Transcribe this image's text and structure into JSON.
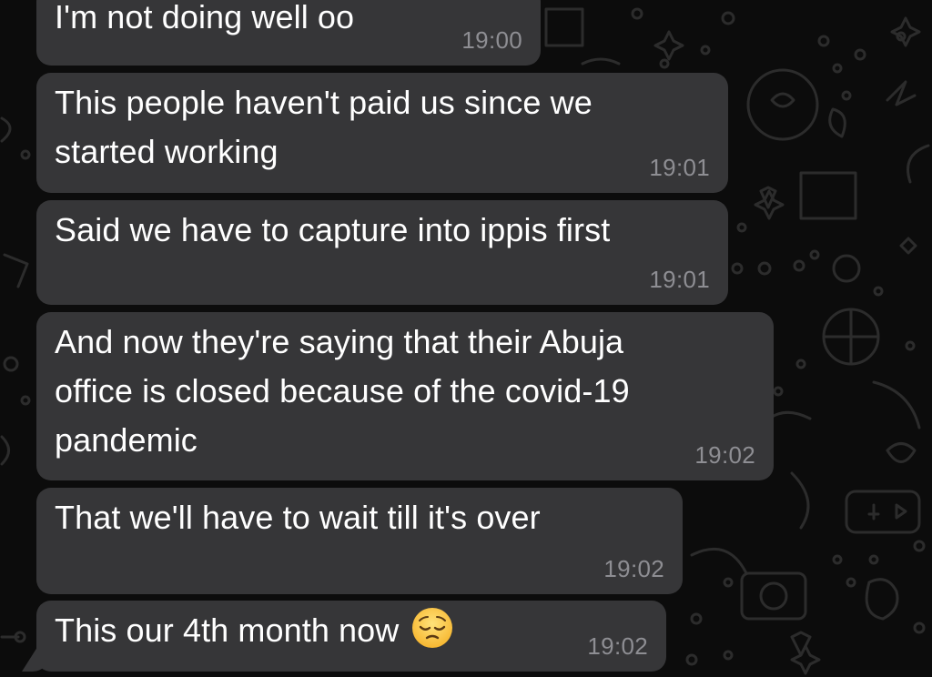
{
  "messages": [
    {
      "text": "I'm not doing well oo",
      "time": "19:00"
    },
    {
      "text": "This people haven't paid us since we",
      "text2": "started working",
      "time": "19:01"
    },
    {
      "text": "Said we have to capture into ippis first",
      "time": "19:01"
    },
    {
      "text": "And now they're saying that their Abuja",
      "text2": "office is closed because of the covid-19",
      "text3": "pandemic",
      "time": "19:02"
    },
    {
      "text": "That we'll have to wait till it's over",
      "time": "19:02"
    },
    {
      "text": "This our 4th month now",
      "emoji": "pensive-face-emoji",
      "time": "19:02"
    }
  ],
  "colors": {
    "background": "#0c0c0c",
    "bubble": "#363638",
    "text": "#ffffff",
    "timestamp": "#8e8e93",
    "wallpaper_doodles": "#2a2a2a"
  }
}
